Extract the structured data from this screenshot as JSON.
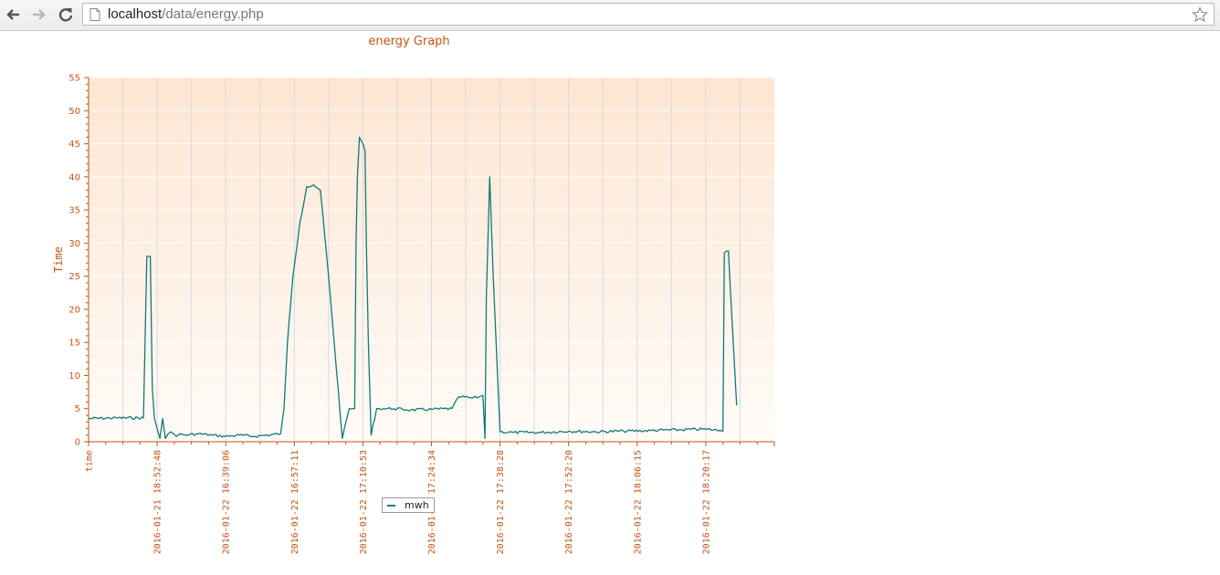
{
  "browser": {
    "back_icon": "arrow-left",
    "forward_icon": "arrow-right",
    "reload_icon": "reload",
    "page_icon": "document",
    "bookmark_icon": "star",
    "url_host": "localhost",
    "url_path": "/data/energy.php"
  },
  "colors": {
    "series": "#0f7a7a",
    "text": "#c35617",
    "plot_top": "#fde6d2",
    "plot_bottom": "#fffbf7"
  },
  "chart_data": {
    "type": "line",
    "title": "energy Graph",
    "ylabel": "Time",
    "ylim": [
      0,
      55
    ],
    "yticks": [
      0,
      5,
      10,
      15,
      20,
      25,
      30,
      35,
      40,
      45,
      50,
      55
    ],
    "x_tick_labels": [
      "time",
      "2016-01-21 18:52:48",
      "2016-01-22 16:39:06",
      "2016-01-22 16:57:11",
      "2016-01-22 17:10:53",
      "2016-01-22 17:24:34",
      "2016-01-22 17:38:28",
      "2016-01-22 17:52:20",
      "2016-01-22 18:06:15",
      "2016-01-22 18:20:17"
    ],
    "grid": true,
    "legend": "bottom-center",
    "series": [
      {
        "name": "mwh",
        "x": [
          0,
          0.4,
          0.8,
          0.85,
          0.9,
          0.93,
          0.96,
          1.0,
          1.04,
          1.08,
          1.12,
          1.16,
          1.2,
          1.24,
          1.28,
          1.33,
          1.4,
          1.6,
          1.8,
          2.0,
          2.2,
          2.4,
          2.6,
          2.8,
          2.85,
          2.9,
          2.98,
          3.08,
          3.18,
          3.28,
          3.38,
          3.5,
          3.7,
          3.8,
          3.88,
          3.9,
          3.92,
          3.95,
          4.0,
          4.03,
          4.05,
          4.08,
          4.12,
          4.2,
          4.3,
          4.45,
          4.7,
          5.0,
          5.3,
          5.4,
          5.6,
          5.7,
          5.75,
          5.78,
          5.8,
          5.85,
          5.9,
          6.0,
          6.2,
          6.6,
          7.0,
          7.4,
          7.8,
          8.2,
          8.6,
          9.0,
          9.2,
          9.25,
          9.27,
          9.3,
          9.33,
          9.45
        ],
        "y": [
          3.5,
          3.6,
          3.6,
          28,
          28,
          8,
          3.5,
          2,
          0.5,
          3.5,
          0.5,
          1.2,
          1.5,
          1.2,
          0.8,
          1.2,
          1.0,
          1.2,
          1.0,
          0.8,
          1.0,
          0.8,
          1.0,
          1.2,
          5,
          15,
          25,
          33,
          38.5,
          38.8,
          38,
          25,
          0.5,
          5,
          5,
          30,
          40,
          46,
          45,
          44,
          30,
          15,
          1.0,
          5,
          5,
          5,
          4.8,
          4.9,
          5,
          6.8,
          6.6,
          6.8,
          7.0,
          0.5,
          22,
          40,
          25,
          1.5,
          1.4,
          1.4,
          1.6,
          1.5,
          1.6,
          1.7,
          1.8,
          1.9,
          1.7,
          1.6,
          28.5,
          28.8,
          28.8,
          5.5
        ]
      }
    ]
  }
}
